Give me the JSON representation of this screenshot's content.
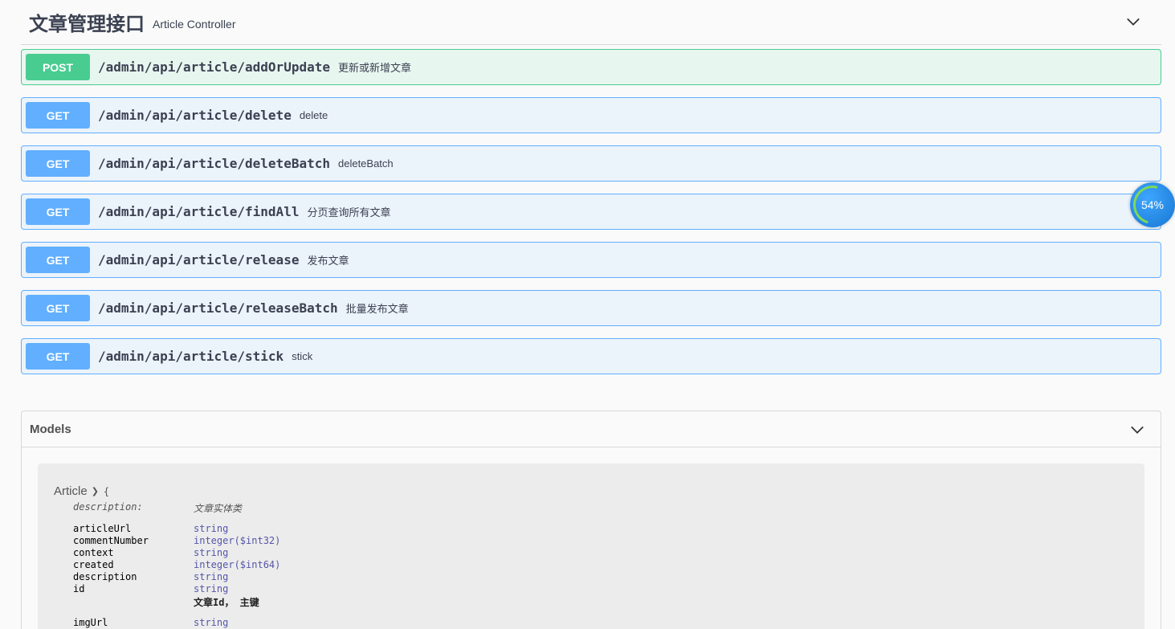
{
  "tag": {
    "title": "文章管理接口",
    "description": "Article Controller"
  },
  "operations": [
    {
      "method": "POST",
      "path": "/admin/api/article/addOrUpdate",
      "summary": "更新或新增文章"
    },
    {
      "method": "GET",
      "path": "/admin/api/article/delete",
      "summary": "delete"
    },
    {
      "method": "GET",
      "path": "/admin/api/article/deleteBatch",
      "summary": "deleteBatch"
    },
    {
      "method": "GET",
      "path": "/admin/api/article/findAll",
      "summary": "分页查询所有文章"
    },
    {
      "method": "GET",
      "path": "/admin/api/article/release",
      "summary": "发布文章"
    },
    {
      "method": "GET",
      "path": "/admin/api/article/releaseBatch",
      "summary": "批量发布文章"
    },
    {
      "method": "GET",
      "path": "/admin/api/article/stick",
      "summary": "stick"
    }
  ],
  "models": {
    "title": "Models",
    "model": {
      "name": "Article",
      "open_brace": "{",
      "description_label": "description:",
      "description_value": "文章实体类",
      "properties": [
        {
          "name": "articleUrl",
          "type": "string"
        },
        {
          "name": "commentNumber",
          "type": "integer($int32)"
        },
        {
          "name": "context",
          "type": "string"
        },
        {
          "name": "created",
          "type": "integer($int64)"
        },
        {
          "name": "description",
          "type": "string"
        },
        {
          "name": "id",
          "type": "string",
          "note": "文章Id， 主键"
        },
        {
          "name": "imgUrl",
          "type": "string"
        }
      ]
    }
  },
  "progress_badge": {
    "text": "54%",
    "value": 54
  },
  "colors": {
    "get": "#61affe",
    "post": "#49cc90"
  }
}
